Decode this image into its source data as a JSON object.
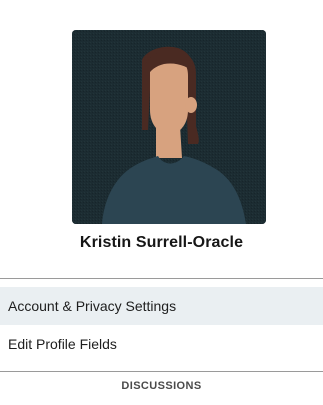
{
  "profile": {
    "name": "Kristin Surrell-Oracle",
    "avatar_icon": "person-silhouette-icon",
    "colors": {
      "avatar_background": "#1c2c32",
      "hair": "#4a2a22",
      "skin": "#d7a27f",
      "shirt": "#2c4552"
    }
  },
  "menu": {
    "items": [
      {
        "label": "Account & Privacy Settings",
        "active": true
      },
      {
        "label": "Edit Profile Fields",
        "active": false
      }
    ],
    "active_background": "#eaeff2"
  },
  "section": {
    "label": "DISCUSSIONS"
  }
}
